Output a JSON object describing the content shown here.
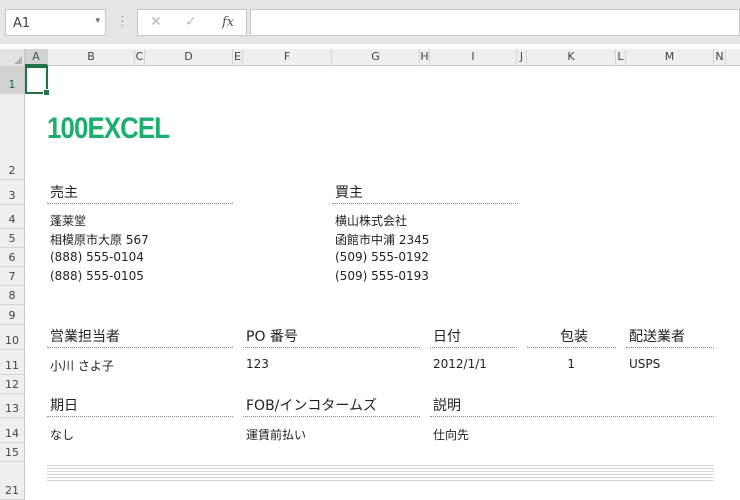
{
  "formula_bar": {
    "name_box": "A1",
    "dropdown_glyph": "▾",
    "separator_glyph": "⋮",
    "cancel_glyph": "✕",
    "enter_glyph": "✓",
    "fx_glyph": "fx",
    "formula": ""
  },
  "columns": [
    "A",
    "B",
    "C",
    "D",
    "E",
    "F",
    "G",
    "H",
    "I",
    "J",
    "K",
    "L",
    "M",
    "N"
  ],
  "rows": [
    "1",
    "2",
    "3",
    "4",
    "5",
    "6",
    "7",
    "8",
    "9",
    "10",
    "11",
    "12",
    "13",
    "14",
    "15",
    "21"
  ],
  "logo": "100EXCEL",
  "seller": {
    "header": "売主",
    "name": "蓬莱堂",
    "address": "相模原市大原 567",
    "phone1": "(888) 555-0104",
    "phone2": "(888) 555-0105"
  },
  "buyer": {
    "header": "買主",
    "name": "横山株式会社",
    "address": "函館市中浦 2345",
    "phone1": "(509) 555-0192",
    "phone2": "(509) 555-0193"
  },
  "order": {
    "sales_rep_label": "営業担当者",
    "sales_rep": "小川 さよ子",
    "po_label": "PO 番号",
    "po": "123",
    "date_label": "日付",
    "date": "2012/1/1",
    "package_label": "包装",
    "package": "1",
    "carrier_label": "配送業者",
    "carrier": "USPS"
  },
  "terms": {
    "due_label": "期日",
    "due": "なし",
    "fob_label": "FOB/インコタームズ",
    "fob": "運賃前払い",
    "description_label": "説明",
    "description": "仕向先"
  }
}
